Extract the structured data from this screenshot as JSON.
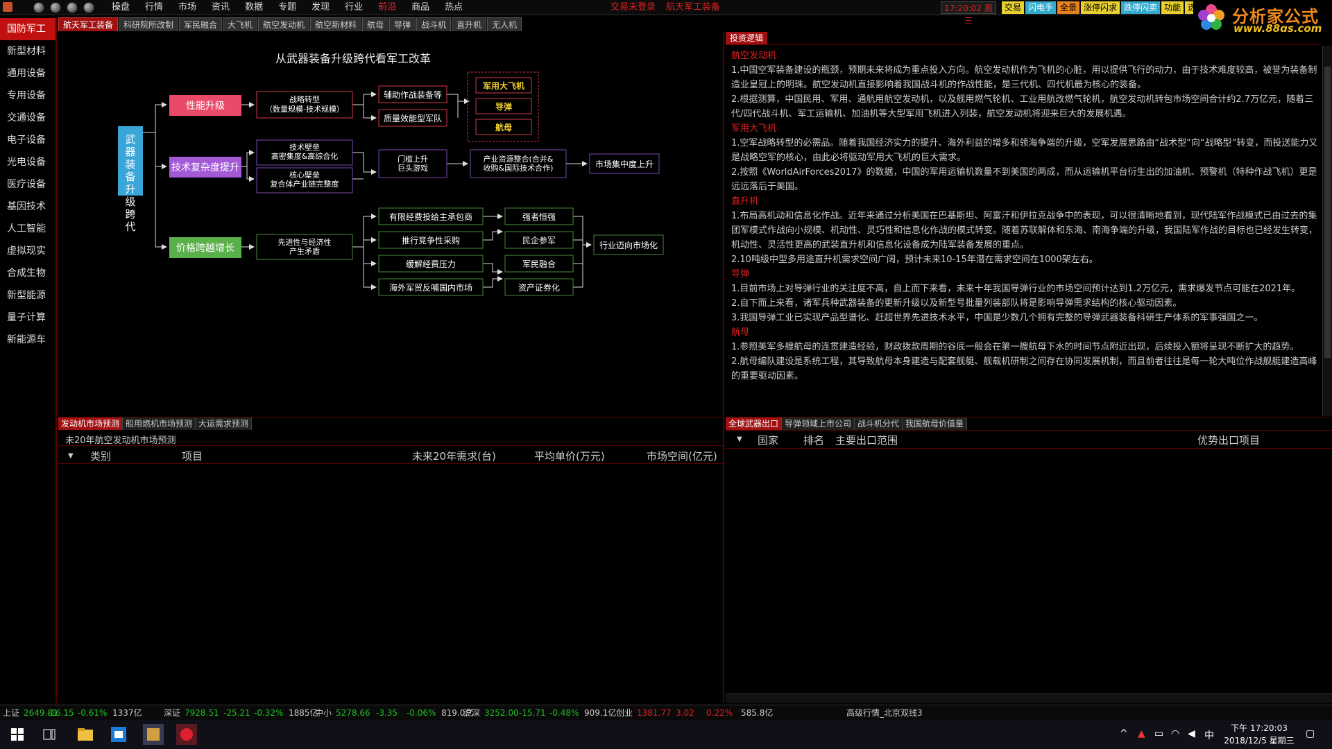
{
  "topbar": {
    "menu": [
      "操盘",
      "行情",
      "市场",
      "资讯",
      "数据",
      "专题",
      "发现",
      "行业",
      "前沿",
      "商品",
      "热点"
    ],
    "active_menu": "前沿",
    "warn": "交易未登录",
    "context": "航天军工装备",
    "clock": "17:20:02 周三",
    "quick_buttons": [
      "交易",
      "闪电手",
      "全景",
      "涨停闪求",
      "跌停闪卖",
      "功能",
      "选"
    ]
  },
  "brand": {
    "name": "分析家公式网",
    "url": "www.88gs.com"
  },
  "tabs": [
    "航天军工装备",
    "科研院所改制",
    "军民融合",
    "大飞机",
    "航空发动机",
    "航空新材料",
    "航母",
    "导弹",
    "战斗机",
    "直升机",
    "无人机"
  ],
  "sidebar": [
    "国防军工",
    "新型材料",
    "通用设备",
    "专用设备",
    "交通设备",
    "电子设备",
    "光电设备",
    "医疗设备",
    "基因技术",
    "人工智能",
    "虚拟现实",
    "合成生物",
    "新型能源",
    "量子计算",
    "新能源车"
  ],
  "diagram": {
    "title": "从武器装备升级跨代看军工改革",
    "root": "武器装备升级跨代",
    "perf": "性能升级",
    "tech": "技术复杂度提升",
    "price": "价格跨越增长",
    "strategy": [
      "战略转型",
      "（数量规模-技术规模）"
    ],
    "aux": "辅助作战装备等",
    "quality": "质量效能型军队",
    "heavy": [
      "军用大飞机",
      "导弹",
      "航母"
    ],
    "tech_barrier": [
      "技术壁垒",
      "高密集度&高综合化"
    ],
    "core_barrier": [
      "核心壁垒",
      "复合体产业链完整度"
    ],
    "threshold": [
      "门槛上升",
      "巨头游戏"
    ],
    "integrate": [
      "产业资源整合(合并&",
      "收购&国际技术合作)"
    ],
    "concentration": "市场集中度上升",
    "advanced": [
      "先进性与经济性",
      "产生矛盾"
    ],
    "limited": "有限经费投给主承包商",
    "competitive": "推行竞争性采购",
    "relieve": "缓解经费压力",
    "overseas": "海外军贸反哺国内市场",
    "strong": "强者恒强",
    "private": "民企参军",
    "civil": "军民融合",
    "securitize": "资产证券化",
    "market": "行业迈向市场化"
  },
  "logic": {
    "tab": "投资逻辑",
    "sections": [
      {
        "title": "航空发动机",
        "paras": [
          "1.中国空军装备建设的瓶颈，预期未来将成为重点投入方向。航空发动机作为飞机的心脏，用以提供飞行的动力，由于技术难度较高，被誉为装备制造业皇冠上的明珠。航空发动机直接影响着我国战斗机的作战性能，是三代机、四代机最为核心的装备。",
          "2.根据测算，中国民用、军用、通航用航空发动机，以及舰用燃气轮机、工业用航改燃气轮机，航空发动机转包市场空间合计约2.7万亿元，随着三代/四代战斗机、军工运输机、加油机等大型军用飞机进入列装，航空发动机将迎来巨大的发展机遇。"
        ]
      },
      {
        "title": "军用大飞机",
        "paras": [
          "1.空军战略转型的必需品。随着我国经济实力的提升、海外利益的增多和领海争端的升级，空军发展思路由“战术型”向“战略型”转变，而投送能力又是战略空军的核心，由此必将驱动军用大飞机的巨大需求。",
          "2.按照《WorldAirForces2017》的数据，中国的军用运输机数量不到美国的两成，而从运输机平台衍生出的加油机、预警机（特种作战飞机）更是远远落后于美国。"
        ]
      },
      {
        "title": "直升机",
        "paras": [
          "1.布局高机动和信息化作战。近年来通过分析美国在巴基斯坦、阿富汗和伊拉克战争中的表现，可以很清晰地看到，现代陆军作战模式已由过去的集团军模式作战向小规模、机动性、灵巧性和信息化作战的模式转变。随着苏联解体和东海、南海争端的升级，我国陆军作战的目标也已经发生转变，机动性、灵活性更高的武装直升机和信息化设备成为陆军装备发展的重点。",
          "2.10吨级中型多用途直升机需求空间广阔，预计未来10-15年潜在需求空间在1000架左右。"
        ]
      },
      {
        "title": "导弹",
        "paras": [
          "1.目前市场上对导弹行业的关注度不高，自上而下来看，未来十年我国导弹行业的市场空间预计达到1.2万亿元，需求爆发节点可能在2021年。",
          "2.自下而上来看，诸军兵种武器装备的更新升级以及新型号批量列装部队将是影响导弹需求结构的核心驱动因素。",
          "3.我国导弹工业已实现产品型谱化、赶超世界先进技术水平，中国是少数几个拥有完整的导弹武器装备科研生产体系的军事强国之一。"
        ]
      },
      {
        "title": "航母",
        "paras": [
          "1.参照美军多艘航母的连贯建造经验，财政拨款周期的谷底一般会在第一艘航母下水的时间节点附近出现，后续投入额将呈现不断扩大的趋势。",
          "2.航母编队建设是系统工程，其导致航母本身建造与配套舰艇、舰载机研制之间存在协同发展机制，而且前者往往是每一轮大吨位作战舰艇建造高峰的重要驱动因素。"
        ]
      }
    ]
  },
  "engine_panel": {
    "tabs": [
      "发动机市场预测",
      "船用燃机市场预测",
      "大运需求预测"
    ],
    "caption": "未20年航空发动机市场预测",
    "headers": [
      "类别",
      "项目",
      "未来20年需求(台)",
      "平均单价(万元)",
      "市场空间(亿元)"
    ]
  },
  "export_panel": {
    "tabs": [
      "全球武器出口",
      "导弹领域上市公司",
      "战斗机分代",
      "我国航母价值量"
    ],
    "headers": [
      "国家",
      "排名",
      "主要出口范围",
      "优势出口项目"
    ]
  },
  "ticker": [
    {
      "label": "上证",
      "value": "2649.81",
      "change": "-16.15",
      "pct": "-0.61%",
      "amount": "1337亿"
    },
    {
      "label": "深证",
      "value": "7928.51",
      "change": "-25.21",
      "pct": "-0.32%",
      "amount": "1885亿"
    },
    {
      "label": "中小",
      "value": "5278.66",
      "change": "-3.35",
      "pct": "-0.06%",
      "amount": "819.0亿"
    },
    {
      "label": "沪深",
      "value": "3252.00",
      "change": "-15.71",
      "pct": "-0.48%",
      "amount": "909.1亿"
    },
    {
      "label": "创业",
      "value": "1381.77",
      "change": "3.02",
      "pct": "0.22%",
      "amount": "585.8亿"
    }
  ],
  "ticker_extra": "高级行情_北京双线3",
  "taskbar": {
    "time": "下午 17:20:03",
    "date": "2018/12/5 星期三",
    "ime": "中"
  }
}
